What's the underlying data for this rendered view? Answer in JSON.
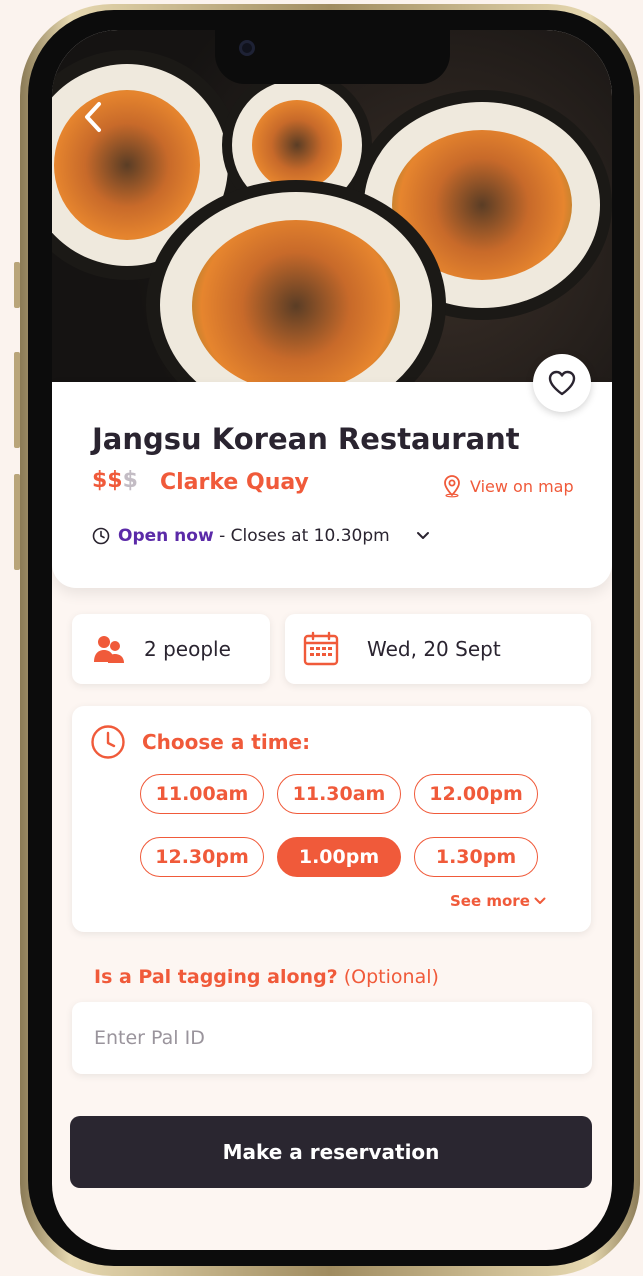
{
  "restaurant": {
    "name": "Jangsu Korean Restaurant",
    "price_active": "$$",
    "price_inactive": "$",
    "location": "Clarke Quay",
    "map_link": "View on map",
    "status_open": "Open now",
    "status_closing": " - Closes at 10.30pm"
  },
  "booking": {
    "party": "2 people",
    "date": "Wed, 20 Sept"
  },
  "time_picker": {
    "label": "Choose a time:",
    "slots": [
      "11.00am",
      "11.30am",
      "12.00pm",
      "12.30pm",
      "1.00pm",
      "1.30pm"
    ],
    "selected_slot": "1.00pm",
    "see_more": "See more"
  },
  "pal": {
    "question_bold": "Is a Pal tagging along?",
    "question_optional": " (Optional)",
    "placeholder": "Enter Pal ID"
  },
  "cta": {
    "label": "Make a reservation"
  },
  "colors": {
    "accent": "#f05a3a",
    "open_status": "#5b2aa8",
    "dark_button": "#2a2630",
    "background": "#fdf6f2"
  },
  "icons": [
    "back-icon",
    "heart-icon",
    "map-pin-icon",
    "clock-icon",
    "chevron-down-icon",
    "people-icon",
    "calendar-icon"
  ]
}
